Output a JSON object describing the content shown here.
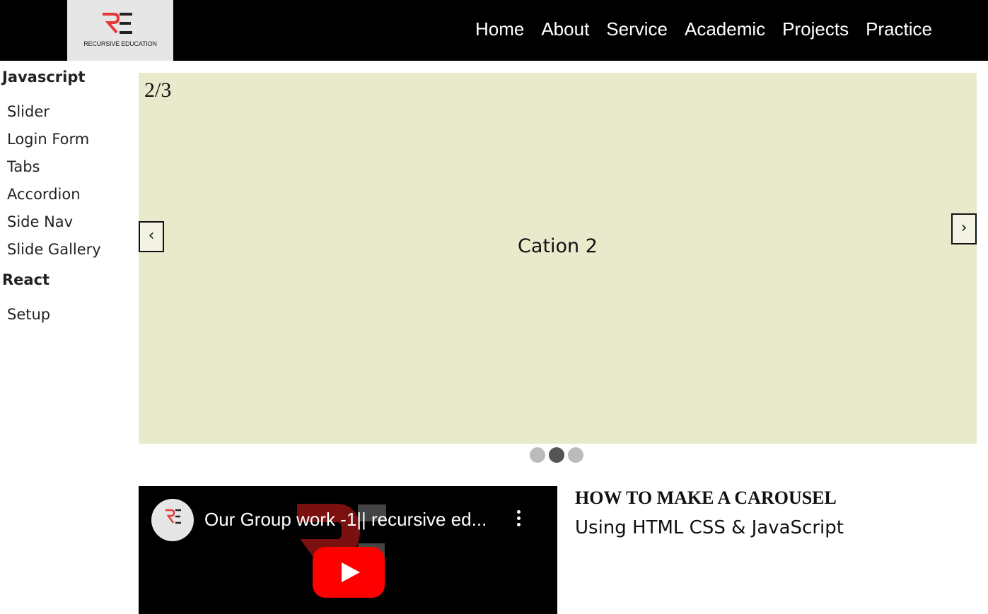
{
  "header": {
    "logo_text": "RECURSIVE EDUCATION",
    "nav": [
      "Home",
      "About",
      "Service",
      "Academic",
      "Projects",
      "Practice"
    ]
  },
  "sidebar": {
    "sections": [
      {
        "heading": "Javascript",
        "items": [
          "Slider",
          "Login Form",
          "Tabs",
          "Accordion",
          "Side Nav",
          "Slide Gallery"
        ]
      },
      {
        "heading": "React",
        "items": [
          "Setup"
        ]
      }
    ]
  },
  "slider": {
    "counter": "2/3",
    "caption": "Cation 2",
    "prev_label": "‹",
    "next_label": "›",
    "dots": 3,
    "active_dot": 2,
    "background": "#e9eacc"
  },
  "video": {
    "title": "Our Group work -1|| recursive ed...",
    "play_icon": "play-icon",
    "menu_icon": "more-vertical-icon"
  },
  "article": {
    "heading": "HOW TO MAKE A CAROUSEL",
    "subheading": "Using HTML CSS & JavaScript"
  },
  "colors": {
    "header_bg": "#000000",
    "logo_bg": "#e6e6e6",
    "brand_red": "#e53935",
    "dot_active": "#555555",
    "dot_inactive": "#bbbbbb"
  }
}
